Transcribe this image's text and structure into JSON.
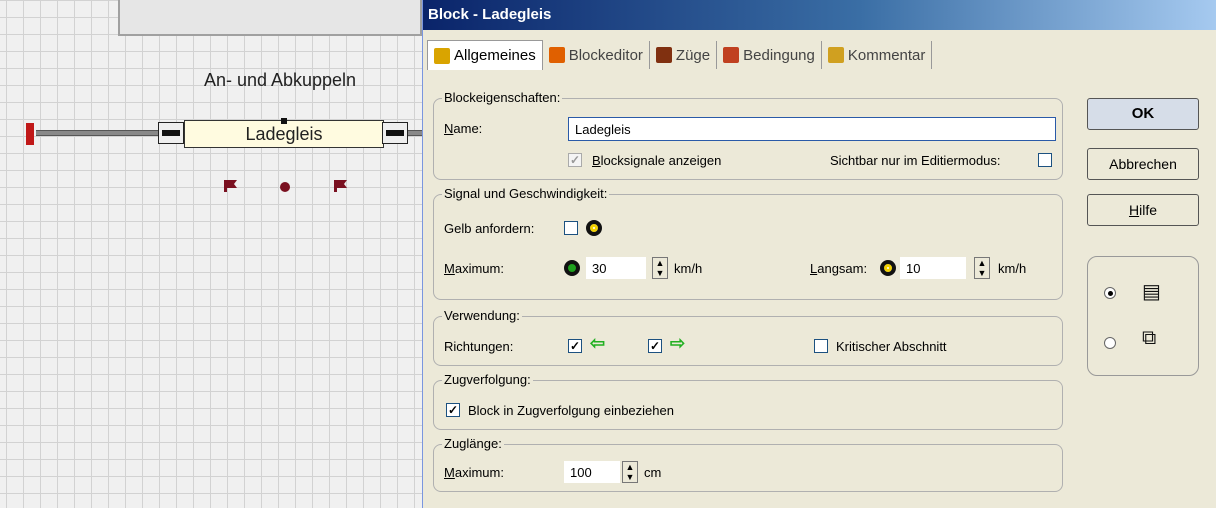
{
  "plan": {
    "title": "An- und Abkuppeln",
    "block_label": "Ladegleis"
  },
  "dialog": {
    "title": "Block - Ladegleis",
    "tabs": [
      {
        "label": "Allgemeines",
        "icon": "general-icon",
        "color": "#d9a400"
      },
      {
        "label": "Blockeditor",
        "icon": "block-editor-icon",
        "color": "#e06000"
      },
      {
        "label": "Züge",
        "icon": "trains-icon",
        "color": "#803010"
      },
      {
        "label": "Bedingung",
        "icon": "condition-icon",
        "color": "#c04020"
      },
      {
        "label": "Kommentar",
        "icon": "comment-icon",
        "color": "#d0a020"
      }
    ],
    "blockeigenschaften": {
      "title": "Blockeigenschaften:",
      "name_label": "Name:",
      "name_value": "Ladegleis",
      "show_signals_label": "Blocksignale anzeigen",
      "show_signals_checked": true,
      "visible_edit_label": "Sichtbar nur im Editiermodus:",
      "visible_edit_checked": false
    },
    "signal": {
      "title": "Signal und Geschwindigkeit:",
      "yellow_label": "Gelb anfordern:",
      "yellow_checked": false,
      "maximum_label": "Maximum:",
      "maximum_value": "30",
      "maximum_unit": "km/h",
      "slow_label": "Langsam:",
      "slow_value": "10",
      "slow_unit": "km/h"
    },
    "verwendung": {
      "title": "Verwendung:",
      "directions_label": "Richtungen:",
      "dir_left_checked": true,
      "dir_right_checked": true,
      "critical_label": "Kritischer Abschnitt",
      "critical_checked": false
    },
    "zugverfolgung": {
      "title": "Zugverfolgung:",
      "include_label": "Block in Zugverfolgung einbeziehen",
      "include_checked": true
    },
    "zuglaenge": {
      "title": "Zuglänge:",
      "maximum_label": "Maximum:",
      "maximum_value": "100",
      "unit": "cm"
    },
    "buttons": {
      "ok": "OK",
      "cancel": "Abbrechen",
      "help": "Hilfe"
    },
    "view_mode": {
      "selected": "single-page",
      "options": [
        "single-page-icon",
        "multi-page-icon"
      ]
    },
    "colors": {
      "title_start": "#0a246a",
      "dialog_bg": "#ece9d8",
      "track_red": "#c01818",
      "signal_red": "#7a1020"
    }
  }
}
